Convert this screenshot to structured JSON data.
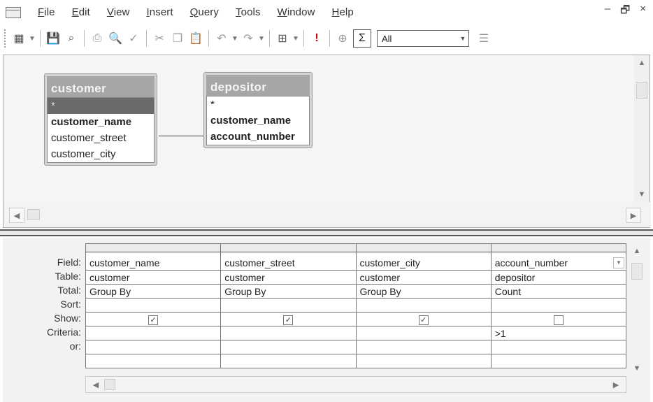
{
  "menu": {
    "items": [
      "File",
      "Edit",
      "View",
      "Insert",
      "Query",
      "Tools",
      "Window",
      "Help"
    ],
    "underline_letters": [
      "F",
      "E",
      "V",
      "I",
      "Q",
      "T",
      "W",
      "H"
    ]
  },
  "window_controls": {
    "minimize": "–",
    "restore": "🗗",
    "close": "×"
  },
  "toolbar": {
    "icons": [
      "view-icon",
      "save-icon",
      "search-icon",
      "print-icon",
      "print-preview-icon",
      "spelling-icon",
      "cut-icon",
      "copy-icon",
      "paste-icon",
      "undo-icon",
      "redo-icon",
      "query-type-icon",
      "run-icon",
      "show-table-icon",
      "totals-icon",
      "top-values-select",
      "properties-icon"
    ],
    "totals_symbol": "Σ",
    "top_values": "All"
  },
  "tables": {
    "customer": {
      "title": "customer",
      "fields": [
        "*",
        "customer_name",
        "customer_street",
        "customer_city"
      ],
      "bold_fields": [
        "customer_name"
      ],
      "selected_field": "*"
    },
    "depositor": {
      "title": "depositor",
      "fields": [
        "*",
        "customer_name",
        "account_number"
      ],
      "bold_fields": [
        "customer_name",
        "account_number"
      ]
    }
  },
  "grid": {
    "row_labels": [
      "Field:",
      "Table:",
      "Total:",
      "Sort:",
      "Show:",
      "Criteria:",
      "or:"
    ],
    "columns": [
      {
        "field": "customer_name",
        "table": "customer",
        "total": "Group By",
        "sort": "",
        "show": true,
        "criteria": "",
        "or": ""
      },
      {
        "field": "customer_street",
        "table": "customer",
        "total": "Group By",
        "sort": "",
        "show": true,
        "criteria": "",
        "or": ""
      },
      {
        "field": "customer_city",
        "table": "customer",
        "total": "Group By",
        "sort": "",
        "show": true,
        "criteria": "",
        "or": ""
      },
      {
        "field": "account_number",
        "table": "depositor",
        "total": "Count",
        "sort": "",
        "show": false,
        "criteria": ">1",
        "or": ""
      }
    ],
    "check_mark": "✓"
  },
  "colors": {
    "title_bar_table": "#9a9a9a",
    "selected_row": "#6a6a6a",
    "pane_bg": "#f5f5f5"
  }
}
